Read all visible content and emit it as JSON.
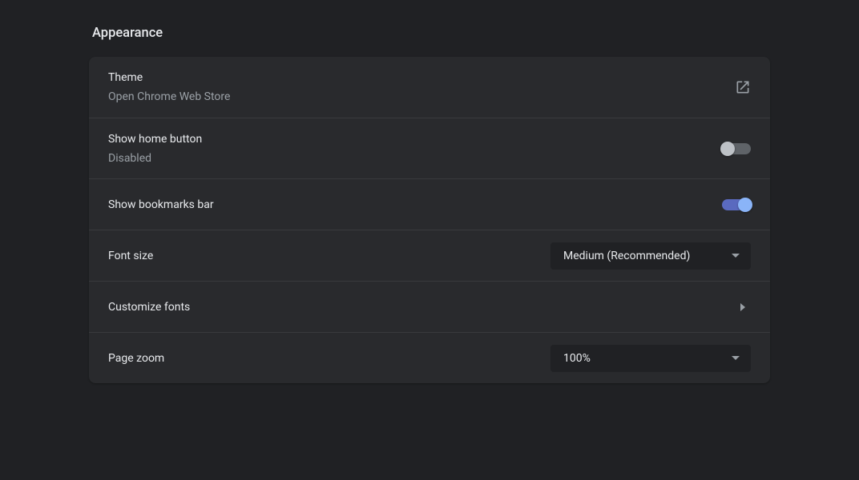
{
  "section": {
    "title": "Appearance"
  },
  "rows": {
    "theme": {
      "title": "Theme",
      "subtitle": "Open Chrome Web Store"
    },
    "home_button": {
      "title": "Show home button",
      "subtitle": "Disabled",
      "enabled": false
    },
    "bookmarks_bar": {
      "title": "Show bookmarks bar",
      "enabled": true
    },
    "font_size": {
      "title": "Font size",
      "value": "Medium (Recommended)"
    },
    "customize_fonts": {
      "title": "Customize fonts"
    },
    "page_zoom": {
      "title": "Page zoom",
      "value": "100%"
    }
  }
}
